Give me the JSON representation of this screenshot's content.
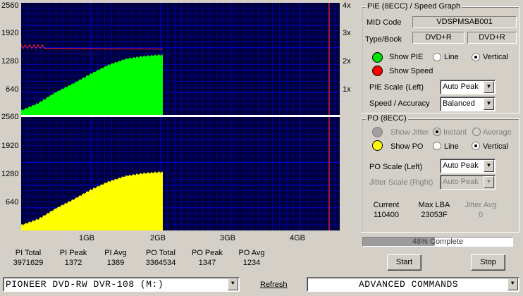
{
  "charts": {
    "top_y_ticks": [
      "2560",
      "1920",
      "1280",
      "640"
    ],
    "bottom_y_ticks": [
      "2560",
      "1920",
      "1280",
      "640"
    ],
    "speed_ticks": [
      "4x",
      "3x",
      "2x",
      "1x"
    ],
    "x_ticks": [
      "1GB",
      "2GB",
      "3GB",
      "4GB"
    ],
    "pie_color": "#00ff00",
    "po_color": "#ffff00",
    "speed_color": "#ff2020",
    "grid_color": "#0000cc",
    "background": "#00003c"
  },
  "chart_data": [
    {
      "type": "area",
      "title": "PIE (8ECC)",
      "ylim": [
        0,
        2560
      ],
      "y2lim": [
        0,
        4
      ],
      "x": [
        0,
        0.25,
        0.5,
        0.75,
        1.0,
        1.25,
        1.5,
        1.75,
        2.0,
        2.03
      ],
      "series": [
        {
          "values": [
            100,
            270,
            520,
            720,
            940,
            1140,
            1280,
            1340,
            1372,
            1372
          ]
        }
      ]
    },
    {
      "type": "area",
      "title": "PO (8ECC)",
      "ylim": [
        0,
        2560
      ],
      "x": [
        0,
        0.25,
        0.5,
        0.75,
        1.0,
        1.25,
        1.5,
        1.75,
        2.0,
        2.03
      ],
      "series": [
        {
          "values": [
            120,
            260,
            500,
            700,
            920,
            1100,
            1230,
            1290,
            1320,
            1320
          ]
        }
      ]
    }
  ],
  "stats": [
    {
      "label": "PI Total",
      "value": "3971629"
    },
    {
      "label": "PI Peak",
      "value": "1372"
    },
    {
      "label": "PI Avg",
      "value": "1389"
    },
    {
      "label": "PO Total",
      "value": "3364534"
    },
    {
      "label": "PO Peak",
      "value": "1347"
    },
    {
      "label": "PO Avg",
      "value": "1234"
    }
  ],
  "pie_group": {
    "title": "PIE (8ECC) / Speed Graph",
    "mid_code_label": "MID Code",
    "mid_code_value": "VDSPMSAB001",
    "type_book_label": "Type/Book",
    "type_value": "DVD+R",
    "book_value": "DVD+R",
    "show_pie": "Show PIE",
    "show_speed": "Show Speed",
    "line": "Line",
    "vertical": "Vertical",
    "scale_label": "PIE Scale (Left)",
    "scale_value": "Auto Peak",
    "speed_label": "Speed / Accuracy",
    "speed_value": "Balanced",
    "pie_ball_color": "#00e000",
    "speed_ball_color": "#ff0000"
  },
  "po_group": {
    "title": "PO (8ECC)",
    "show_jitter": "Show Jitter",
    "instant": "Instant",
    "average": "Average",
    "show_po": "Show PO",
    "line": "Line",
    "vertical": "Vertical",
    "scale_label": "PO Scale (Left)",
    "scale_value": "Auto Peak",
    "jitter_label": "Jitter Scale (Right)",
    "jitter_value": "Auto Peak",
    "current_label": "Current",
    "current_value": "110400",
    "maxlba_label": "Max LBA",
    "maxlba_value": "23053F",
    "jitter_avg_label": "Jitter Avg",
    "jitter_avg_value": "0",
    "po_ball_color": "#ffff00"
  },
  "progress": {
    "text": "48% Complete",
    "fraction": 0.48
  },
  "buttons": {
    "start": "Start",
    "stop": "Stop"
  },
  "bottom": {
    "drive": "PIONEER DVD-RW  DVR-108  (M:)",
    "refresh": "Refresh",
    "commands": "ADVANCED COMMANDS"
  }
}
